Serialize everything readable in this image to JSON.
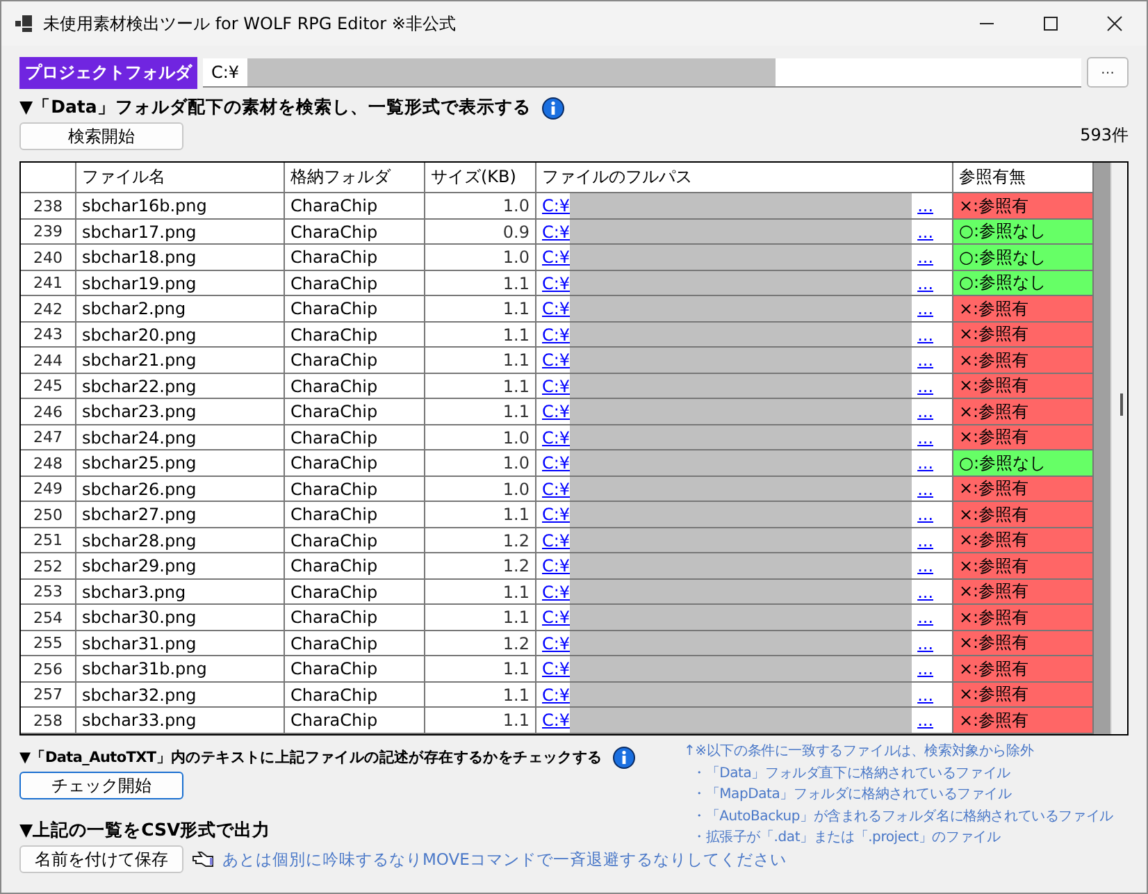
{
  "window": {
    "title": "未使用素材検出ツール for WOLF RPG Editor ※非公式"
  },
  "project_folder": {
    "label": "プロジェクトフォルダ",
    "value": "C:¥",
    "browse_button": "···"
  },
  "search_section": {
    "heading": "▼「Data」フォルダ配下の素材を検索し、一覧形式で表示する",
    "button": "検索開始",
    "count": "593件"
  },
  "table": {
    "columns": [
      "ファイル名",
      "格納フォルダ",
      "サイズ(KB)",
      "ファイルのフルパス",
      "参照有無"
    ],
    "rows": [
      {
        "index": "238",
        "name": "sbchar16b.png",
        "folder": "CharaChip",
        "size": "1.0",
        "path": "C:¥",
        "more": "...",
        "ref": "×:参照有",
        "referenced": true
      },
      {
        "index": "239",
        "name": "sbchar17.png",
        "folder": "CharaChip",
        "size": "0.9",
        "path": "C:¥",
        "more": "...",
        "ref": "○:参照なし",
        "referenced": false
      },
      {
        "index": "240",
        "name": "sbchar18.png",
        "folder": "CharaChip",
        "size": "1.0",
        "path": "C:¥",
        "more": "...",
        "ref": "○:参照なし",
        "referenced": false
      },
      {
        "index": "241",
        "name": "sbchar19.png",
        "folder": "CharaChip",
        "size": "1.1",
        "path": "C:¥",
        "more": "...",
        "ref": "○:参照なし",
        "referenced": false
      },
      {
        "index": "242",
        "name": "sbchar2.png",
        "folder": "CharaChip",
        "size": "1.1",
        "path": "C:¥",
        "more": "...",
        "ref": "×:参照有",
        "referenced": true
      },
      {
        "index": "243",
        "name": "sbchar20.png",
        "folder": "CharaChip",
        "size": "1.1",
        "path": "C:¥",
        "more": "...",
        "ref": "×:参照有",
        "referenced": true
      },
      {
        "index": "244",
        "name": "sbchar21.png",
        "folder": "CharaChip",
        "size": "1.1",
        "path": "C:¥",
        "more": "...",
        "ref": "×:参照有",
        "referenced": true
      },
      {
        "index": "245",
        "name": "sbchar22.png",
        "folder": "CharaChip",
        "size": "1.1",
        "path": "C:¥",
        "more": "...",
        "ref": "×:参照有",
        "referenced": true
      },
      {
        "index": "246",
        "name": "sbchar23.png",
        "folder": "CharaChip",
        "size": "1.1",
        "path": "C:¥",
        "more": "...",
        "ref": "×:参照有",
        "referenced": true
      },
      {
        "index": "247",
        "name": "sbchar24.png",
        "folder": "CharaChip",
        "size": "1.0",
        "path": "C:¥",
        "more": "...",
        "ref": "×:参照有",
        "referenced": true
      },
      {
        "index": "248",
        "name": "sbchar25.png",
        "folder": "CharaChip",
        "size": "1.0",
        "path": "C:¥",
        "more": "...",
        "ref": "○:参照なし",
        "referenced": false
      },
      {
        "index": "249",
        "name": "sbchar26.png",
        "folder": "CharaChip",
        "size": "1.0",
        "path": "C:¥",
        "more": "...",
        "ref": "×:参照有",
        "referenced": true
      },
      {
        "index": "250",
        "name": "sbchar27.png",
        "folder": "CharaChip",
        "size": "1.1",
        "path": "C:¥",
        "more": "...",
        "ref": "×:参照有",
        "referenced": true
      },
      {
        "index": "251",
        "name": "sbchar28.png",
        "folder": "CharaChip",
        "size": "1.2",
        "path": "C:¥",
        "more": "...",
        "ref": "×:参照有",
        "referenced": true
      },
      {
        "index": "252",
        "name": "sbchar29.png",
        "folder": "CharaChip",
        "size": "1.2",
        "path": "C:¥",
        "more": "...",
        "ref": "×:参照有",
        "referenced": true
      },
      {
        "index": "253",
        "name": "sbchar3.png",
        "folder": "CharaChip",
        "size": "1.1",
        "path": "C:¥",
        "more": "...",
        "ref": "×:参照有",
        "referenced": true
      },
      {
        "index": "254",
        "name": "sbchar30.png",
        "folder": "CharaChip",
        "size": "1.1",
        "path": "C:¥",
        "more": "...",
        "ref": "×:参照有",
        "referenced": true
      },
      {
        "index": "255",
        "name": "sbchar31.png",
        "folder": "CharaChip",
        "size": "1.2",
        "path": "C:¥",
        "more": "...",
        "ref": "×:参照有",
        "referenced": true
      },
      {
        "index": "256",
        "name": "sbchar31b.png",
        "folder": "CharaChip",
        "size": "1.1",
        "path": "C:¥",
        "more": "...",
        "ref": "×:参照有",
        "referenced": true
      },
      {
        "index": "257",
        "name": "sbchar32.png",
        "folder": "CharaChip",
        "size": "1.1",
        "path": "C:¥",
        "more": "...",
        "ref": "×:参照有",
        "referenced": true
      },
      {
        "index": "258",
        "name": "sbchar33.png",
        "folder": "CharaChip",
        "size": "1.1",
        "path": "C:¥",
        "more": "...",
        "ref": "×:参照有",
        "referenced": true
      }
    ]
  },
  "check_section": {
    "heading": "▼「Data_AutoTXT」内のテキストに上記ファイルの記述が存在するかをチェックする",
    "button": "チェック開始"
  },
  "csv_section": {
    "heading": "▼上記の一覧をCSV形式で出力",
    "button": "名前を付けて保存",
    "hint": "あとは個別に吟味するなりMOVEコマンドで一斉退避するなりしてください"
  },
  "notes": {
    "heading": "↑※以下の条件に一致するファイルは、検索対象から除外",
    "items": [
      "・「Data」フォルダ直下に格納されているファイル",
      "・「MapData」フォルダに格納されているファイル",
      "・「AutoBackup」が含まれるフォルダ名に格納されているファイル",
      "・拡張子が「.dat」または「.project」のファイル"
    ]
  }
}
